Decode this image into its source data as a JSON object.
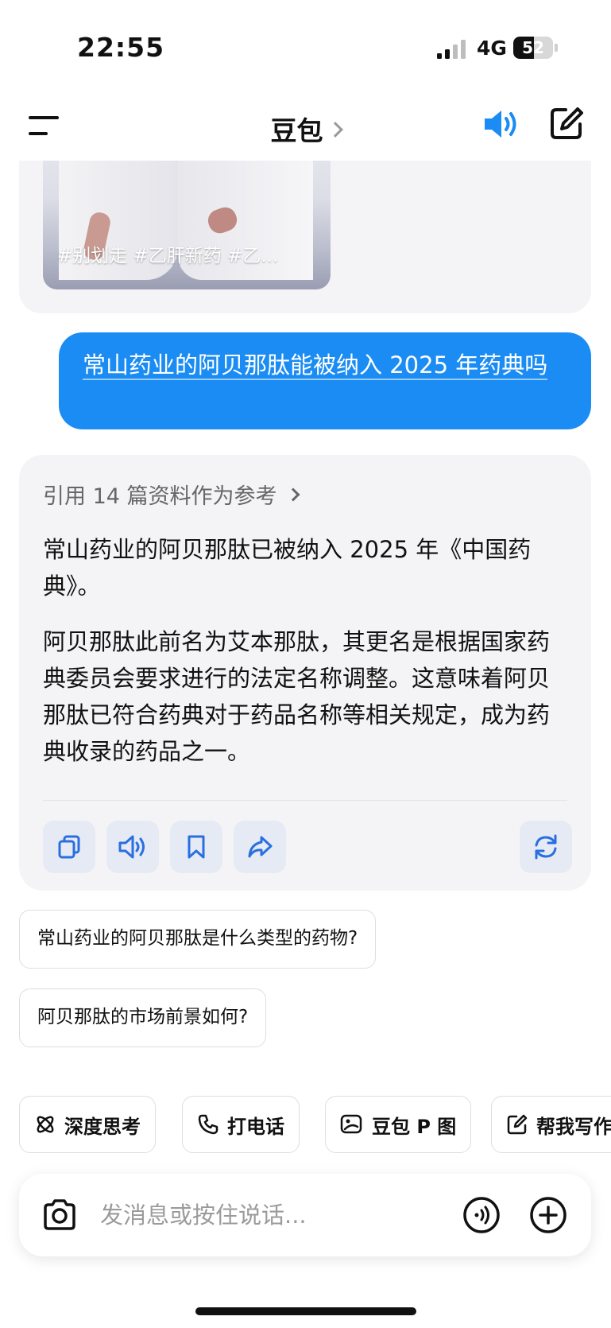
{
  "status_bar": {
    "time": "22:55",
    "network": "4G",
    "battery_level": "52"
  },
  "header": {
    "title": "豆包",
    "icons": [
      "menu-icon",
      "chevron-right-icon",
      "speaker-icon",
      "compose-icon"
    ],
    "accent_color": "#1a8cf3"
  },
  "previous_card": {
    "video_tags": "#别划走 #乙肝新药 #乙..."
  },
  "user_message": {
    "text": "常山药业的阿贝那肽能被纳入 2025 年药典吗"
  },
  "answer": {
    "reference_text": "引用 14 篇资料作为参考",
    "paragraph_1": "常山药业的阿贝那肽已被纳入 2025 年《中国药典》。",
    "paragraph_2": "阿贝那肽此前名为艾本那肽，其更名是根据国家药典委员会要求进行的法定名称调整。这意味着阿贝那肽已符合药典对于药品名称等相关规定，成为药典收录的药品之一。",
    "actions": [
      "copy-icon",
      "read-aloud-icon",
      "bookmark-icon",
      "share-icon",
      "regenerate-icon"
    ]
  },
  "suggestions": [
    "常山药业的阿贝那肽是什么类型的药物?",
    "阿贝那肽的市场前景如何?"
  ],
  "tools": [
    {
      "label": "深度思考",
      "icon": "atom-icon"
    },
    {
      "label": "打电话",
      "icon": "phone-icon"
    },
    {
      "label": "豆包 P 图",
      "icon": "image-edit-icon"
    },
    {
      "label": "帮我写作",
      "icon": "edit-icon"
    }
  ],
  "input": {
    "placeholder": "发消息或按住说话..."
  }
}
